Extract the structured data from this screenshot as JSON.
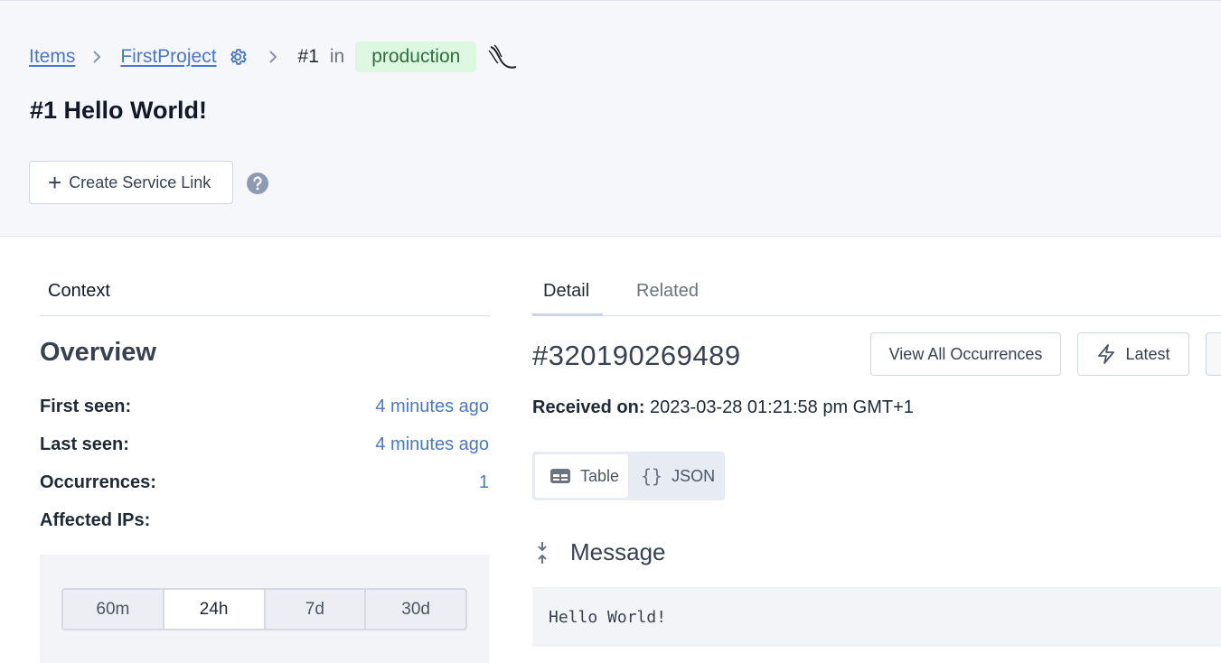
{
  "breadcrumb": {
    "items_label": "Items",
    "project_label": "FirstProject",
    "item_id": "#1",
    "in_label": "in",
    "environment": "production"
  },
  "page": {
    "title": "#1 Hello World!",
    "create_service_link": "Create Service Link"
  },
  "context": {
    "tab_label": "Context",
    "overview_title": "Overview",
    "rows": [
      {
        "label": "First seen:",
        "value": "4 minutes ago"
      },
      {
        "label": "Last seen:",
        "value": "4 minutes ago"
      },
      {
        "label": "Occurrences:",
        "value": "1"
      },
      {
        "label": "Affected IPs:",
        "value": ""
      }
    ],
    "ranges": [
      "60m",
      "24h",
      "7d",
      "30d"
    ],
    "active_range": "24h"
  },
  "detail": {
    "tabs": [
      "Detail",
      "Related"
    ],
    "active_tab": "Detail",
    "occurrence_id": "#320190269489",
    "view_all_label": "View All Occurrences",
    "latest_label": "Latest",
    "received_label": "Received on:",
    "received_value": "2023-03-28 01:21:58 pm GMT+1",
    "view_table_label": "Table",
    "view_json_label": "JSON",
    "message_title": "Message",
    "message_body": "Hello World!"
  },
  "colors": {
    "link": "#4a78c9",
    "env_badge_bg": "#dcf8e0",
    "env_badge_text": "#2f6e3e",
    "header_bg": "#f6f7fb"
  }
}
